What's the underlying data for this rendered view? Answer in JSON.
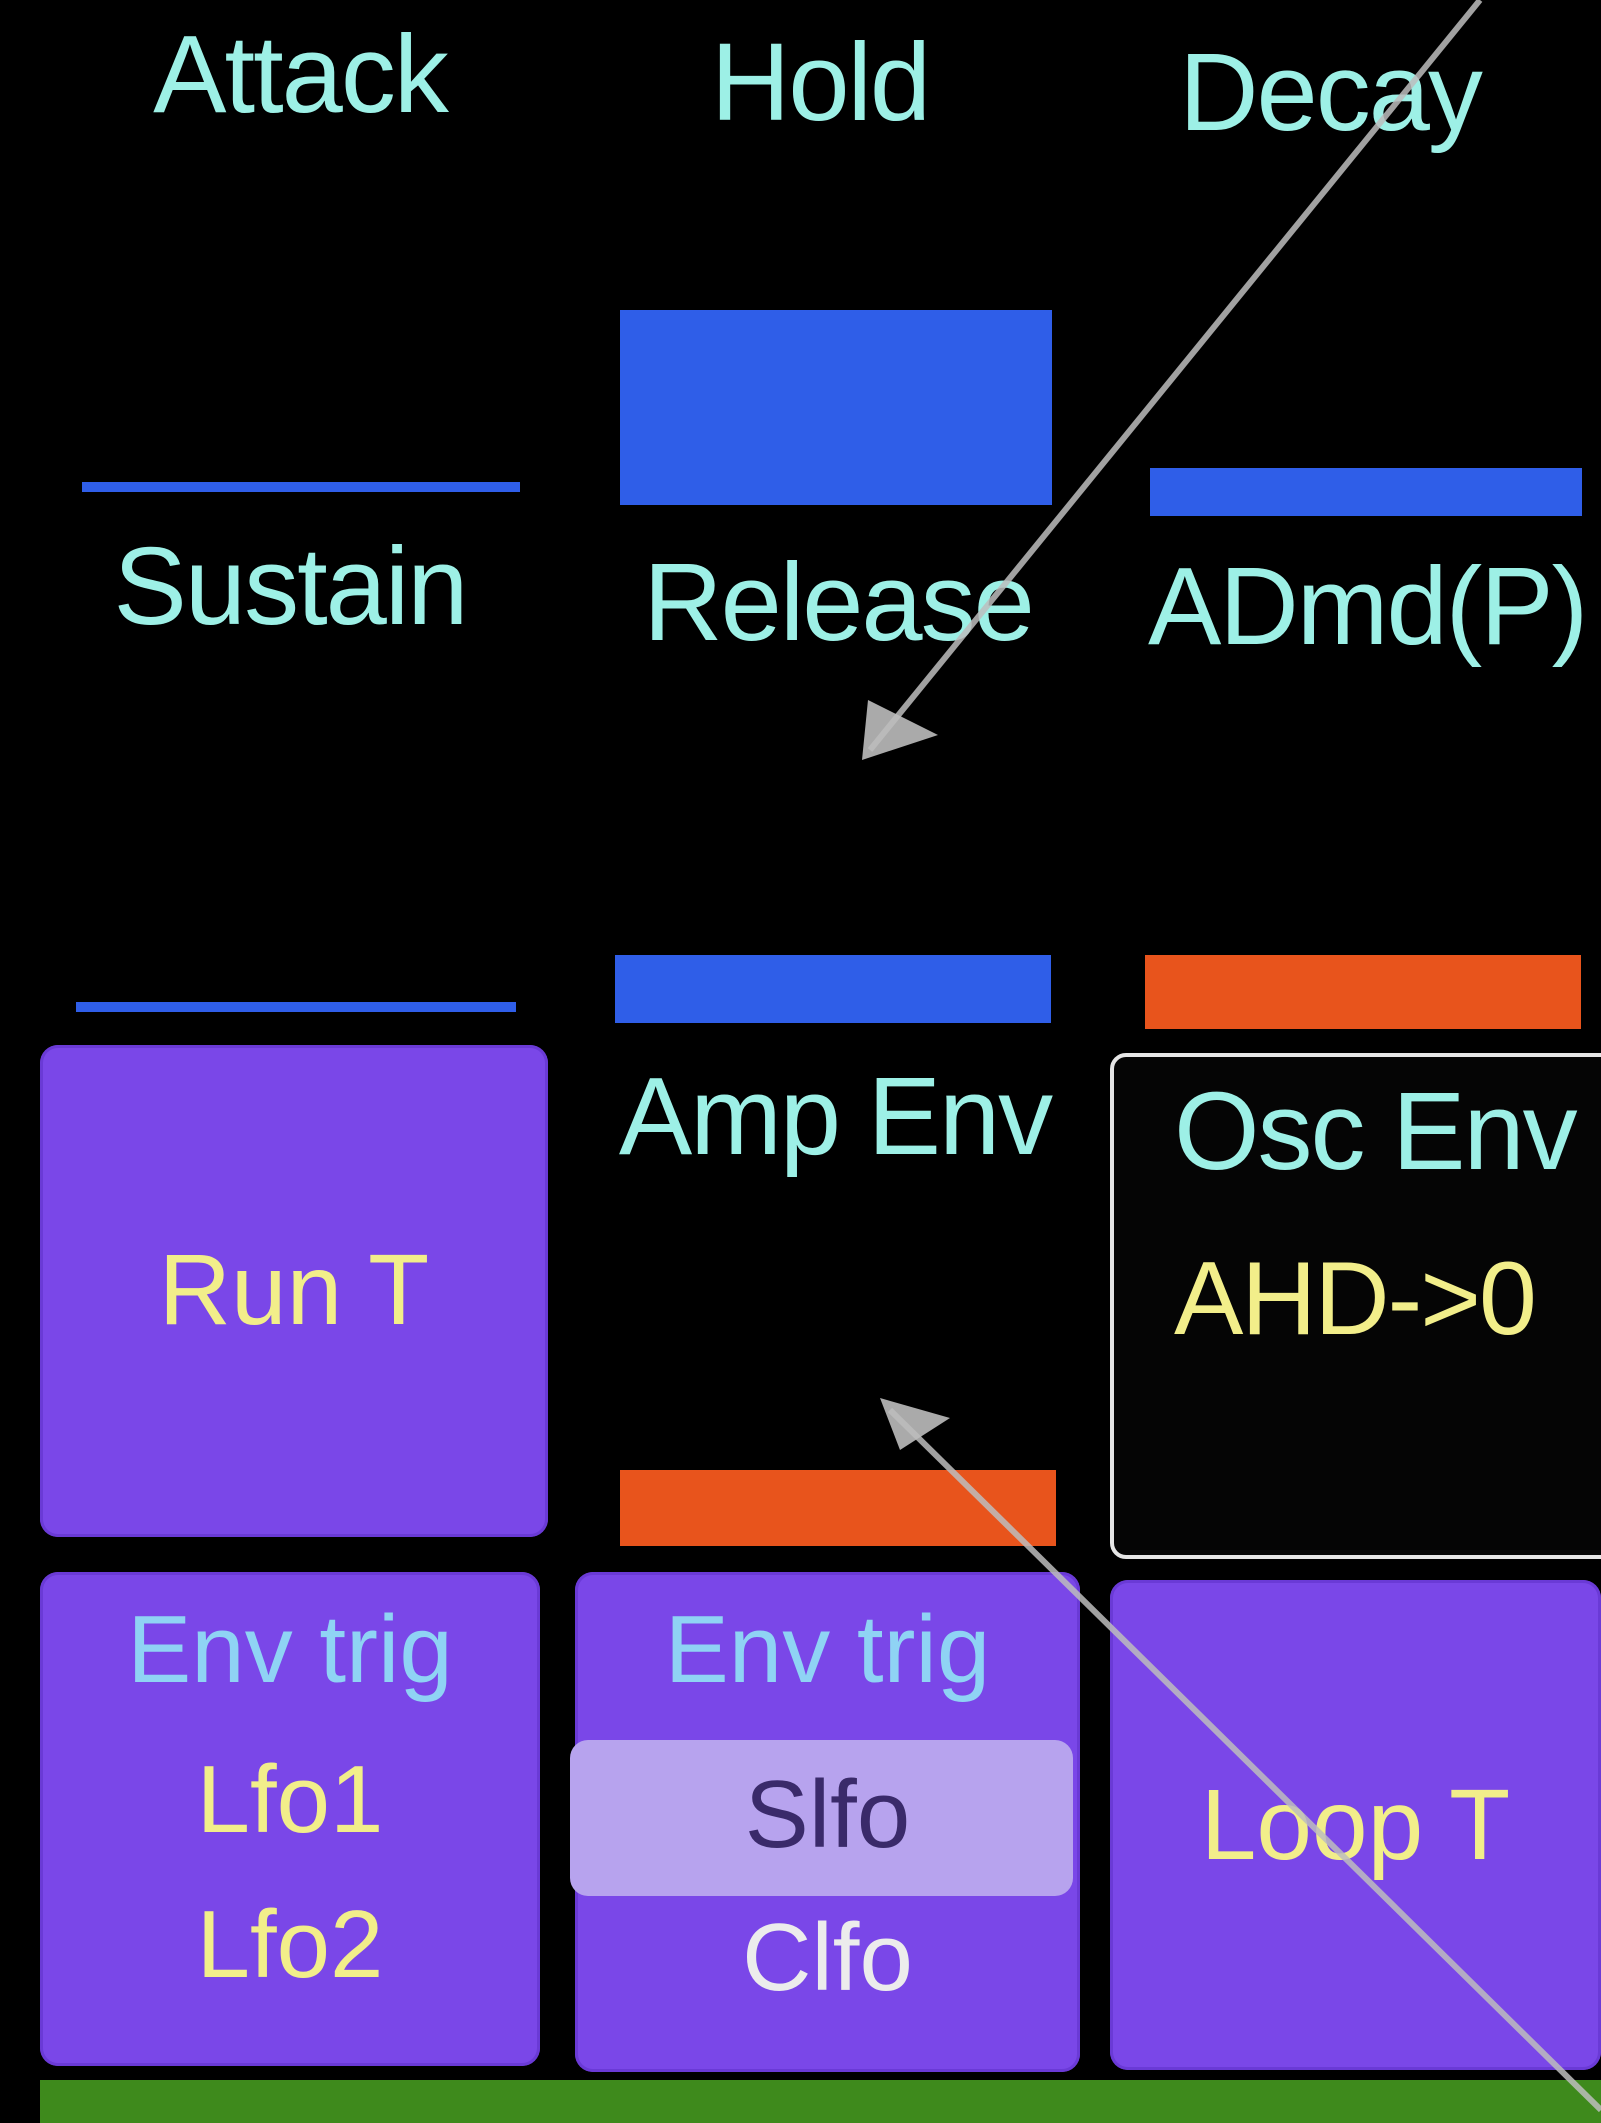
{
  "params": {
    "attack": "Attack",
    "hold": "Hold",
    "decay": "Decay",
    "sustain": "Sustain",
    "release": "Release",
    "admd": "ADmd(P)"
  },
  "envelopes": {
    "amp_env": "Amp Env",
    "osc_env": "Osc Env",
    "osc_env_mode": "AHD->0"
  },
  "buttons": {
    "run_t": "Run T",
    "env_trig_1": {
      "title": "Env trig",
      "opt1": "Lfo1",
      "opt2": "Lfo2"
    },
    "env_trig_2": {
      "title": "Env trig",
      "opt1": "Slfo",
      "opt2": "Clfo",
      "selected": "Slfo"
    },
    "loop_t": "Loop T"
  },
  "colors": {
    "background": "#000000",
    "label_cyan": "#9df0e6",
    "bar_blue": "#2f5ee8",
    "bar_orange": "#e8541c",
    "button_purple": "#7a47e8",
    "selected_purple": "#b7a3ee",
    "text_yellow": "#f2ee8a",
    "text_light_blue": "#8fd3f4",
    "strip_green": "#3e8a1c"
  }
}
